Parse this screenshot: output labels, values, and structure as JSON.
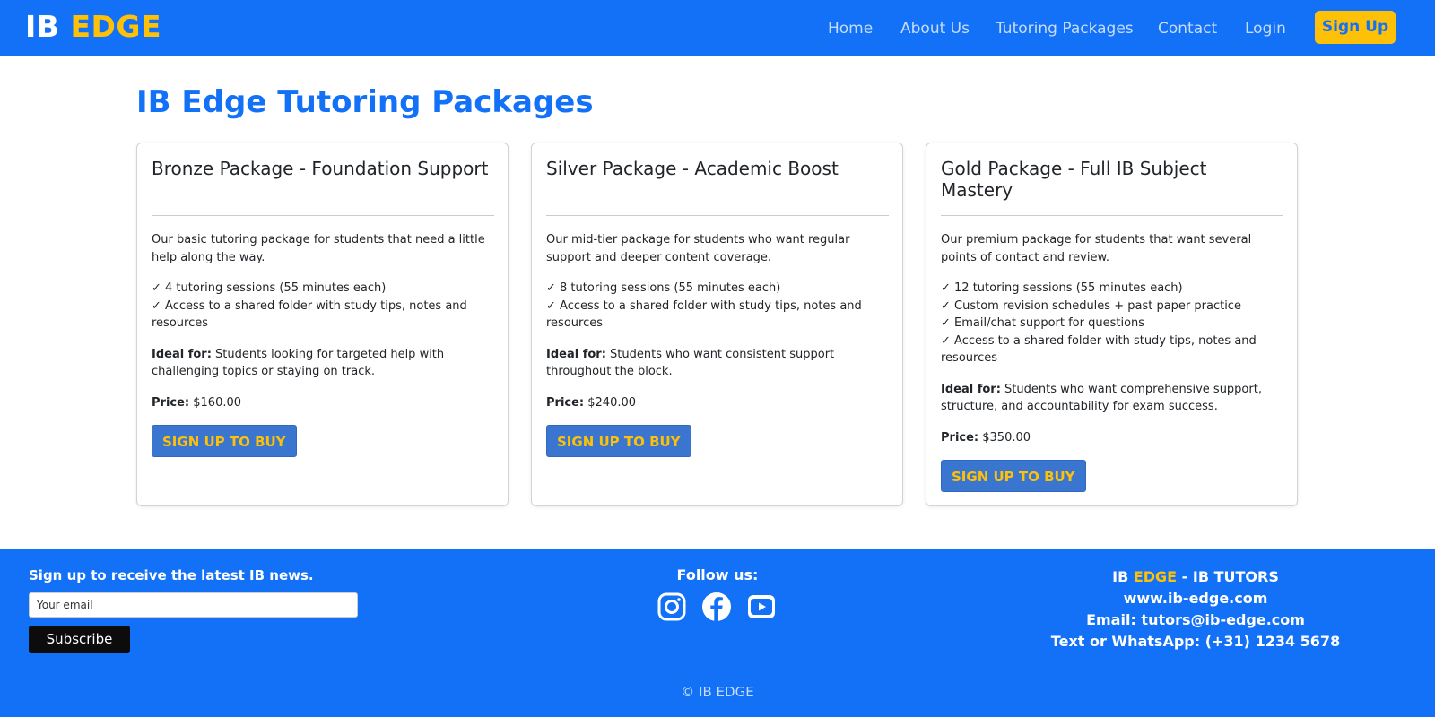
{
  "brand": {
    "ib": "IB",
    "edge": "EDGE"
  },
  "nav": {
    "links": [
      "Home",
      "About Us",
      "Tutoring Packages",
      "Contact",
      "Login"
    ],
    "signup": "Sign Up"
  },
  "page": {
    "title": "IB Edge Tutoring Packages"
  },
  "packages": [
    {
      "title": "Bronze Package - Foundation Support",
      "description": "Our basic tutoring package for students that need a little help along the way.",
      "features": [
        "✓ 4 tutoring sessions (55 minutes each)",
        "✓ Access to a shared folder with study tips, notes and resources"
      ],
      "ideal_label": "Ideal for:",
      "ideal_text": " Students looking for targeted help with challenging topics or staying on track.",
      "price_label": "Price:",
      "price": " $160.00",
      "button": "SIGN UP TO BUY"
    },
    {
      "title": "Silver Package - Academic Boost",
      "description": "Our mid-tier package for students who want regular support and deeper content coverage.",
      "features": [
        "✓ 8 tutoring sessions (55 minutes each)",
        "✓ Access to a shared folder with study tips, notes and resources"
      ],
      "ideal_label": "Ideal for:",
      "ideal_text": " Students who want consistent support throughout the block.",
      "price_label": "Price:",
      "price": " $240.00",
      "button": "SIGN UP TO BUY"
    },
    {
      "title": "Gold Package - Full IB Subject Mastery",
      "description": "Our premium package for students that want several points of contact and review.",
      "features": [
        "✓ 12 tutoring sessions (55 minutes each)",
        "✓ Custom revision schedules + past paper practice",
        "✓ Email/chat support for questions",
        "✓ Access to a shared folder with study tips, notes and resources"
      ],
      "ideal_label": "Ideal for:",
      "ideal_text": " Students who want comprehensive support, structure, and accountability for exam success.",
      "price_label": "Price:",
      "price": " $350.00",
      "button": "SIGN UP TO BUY"
    }
  ],
  "footer": {
    "news_label": "Sign up to receive the latest IB news.",
    "email_placeholder": "Your email",
    "subscribe": "Subscribe",
    "follow": "Follow us:",
    "social_icons": [
      "instagram-icon",
      "facebook-icon",
      "youtube-icon"
    ],
    "contact": {
      "ib": "IB ",
      "edge": "EDGE",
      "suffix": " - IB TUTORS",
      "website": "www.ib-edge.com",
      "email": "Email: tutors@ib-edge.com",
      "phone": "Text or WhatsApp: (+31) 1234 5678"
    },
    "copyright": "© IB EDGE"
  },
  "colors": {
    "primary": "#1271f7",
    "accent": "#ffc107",
    "button": "#3a76cf"
  }
}
